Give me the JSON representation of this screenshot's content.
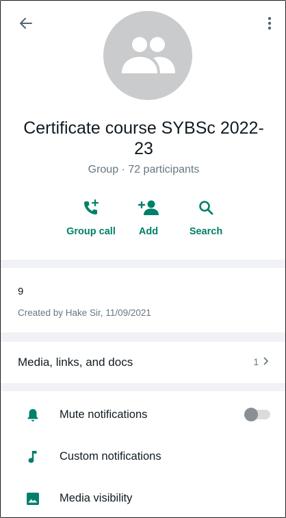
{
  "header": {
    "back_icon": "arrow-left-icon",
    "menu_icon": "more-vertical-icon",
    "avatar_icon": "group-people-icon",
    "title": "Certificate course  SYBSc 2022-23",
    "subtitle": "Group · 72 participants"
  },
  "actions": [
    {
      "label": "Group call",
      "icon": "phone-add-icon"
    },
    {
      "label": "Add",
      "icon": "person-add-icon"
    },
    {
      "label": "Search",
      "icon": "search-icon"
    }
  ],
  "description": {
    "text": "9",
    "created": "Created by Hake Sir, 11/09/2021"
  },
  "media": {
    "label": "Media, links, and docs",
    "count": "1"
  },
  "settings": [
    {
      "label": "Mute notifications",
      "icon": "bell-icon",
      "toggle": false
    },
    {
      "label": "Custom notifications",
      "icon": "music-note-icon"
    },
    {
      "label": "Media visibility",
      "icon": "image-icon"
    }
  ],
  "colors": {
    "accent": "#008069",
    "secondary_text": "#667781",
    "avatar_bg": "#c9cbcd",
    "divider_bg": "#f0f2f5"
  }
}
